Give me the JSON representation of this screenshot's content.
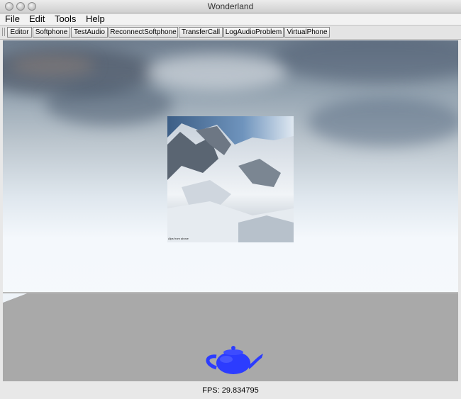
{
  "window": {
    "title": "Wonderland"
  },
  "menu": [
    "File",
    "Edit",
    "Tools",
    "Help"
  ],
  "toolbar": {
    "buttons": [
      "Editor",
      "Softphone",
      "TestAudio",
      "ReconnectSoftphone",
      "TransferCall",
      "LogAudioProblem",
      "VirtualPhone"
    ]
  },
  "scene": {
    "picture_caption": "Alps from above"
  },
  "status": {
    "fps": "FPS: 29.834795"
  },
  "colors": {
    "teapot": "#2c3cff",
    "floor": "#a8a8a8"
  }
}
